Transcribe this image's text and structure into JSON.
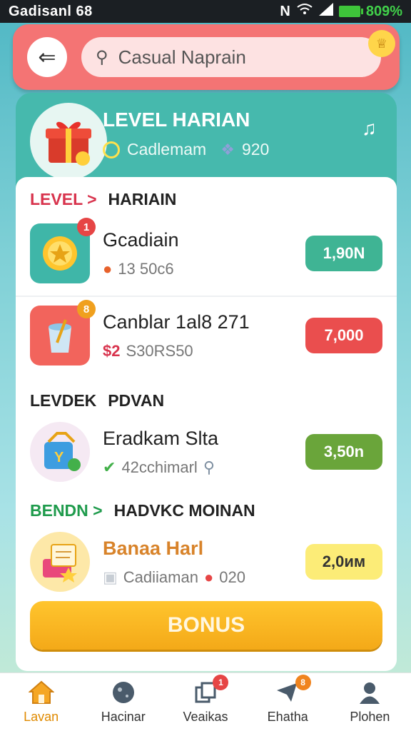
{
  "status_bar": {
    "time": "Gadisanl 68",
    "battery": "809%"
  },
  "header": {
    "search_placeholder": "Casual Naprain"
  },
  "level_card": {
    "title": "LEVEL HARIAN",
    "subtitle": "Cadlemam",
    "gems": "920"
  },
  "sections": [
    {
      "prefix": "LEVEL >",
      "title": "HARIAIN"
    },
    {
      "prefix": "LEVDEK",
      "title": "PDVAN"
    },
    {
      "prefix": "BENDN >",
      "title": "HADVKC MOINAN"
    }
  ],
  "rows": [
    {
      "title": "Gcadiain",
      "sub": "13 50c6",
      "price": "1,90N",
      "badge": "1"
    },
    {
      "title": "Canblar 1al8 271",
      "sub_prefix": "$2",
      "sub": "S30RS50",
      "price": "7,000",
      "badge": "8"
    },
    {
      "title": "Eradkam Slta",
      "sub": "42cchimarl",
      "price": "3,50n"
    },
    {
      "title": "Banaa Harl",
      "sub": "Cadiiaman",
      "sub_extra": "020",
      "price": "2,0им"
    }
  ],
  "bonus_label": "BONUS",
  "nav": [
    {
      "label": "Lavan",
      "active": true
    },
    {
      "label": "Hacinar"
    },
    {
      "label": "Veaikas",
      "badge": "1"
    },
    {
      "label": "Ehatha",
      "badge": "8"
    },
    {
      "label": "Plohen"
    }
  ],
  "colors": {
    "header": "#f47474",
    "teal": "#46b9ad",
    "red_pill": "#ea4e4e",
    "green_pill": "#6aa53a",
    "yellow_pill": "#fcec77",
    "bonus": "#f7b323"
  }
}
